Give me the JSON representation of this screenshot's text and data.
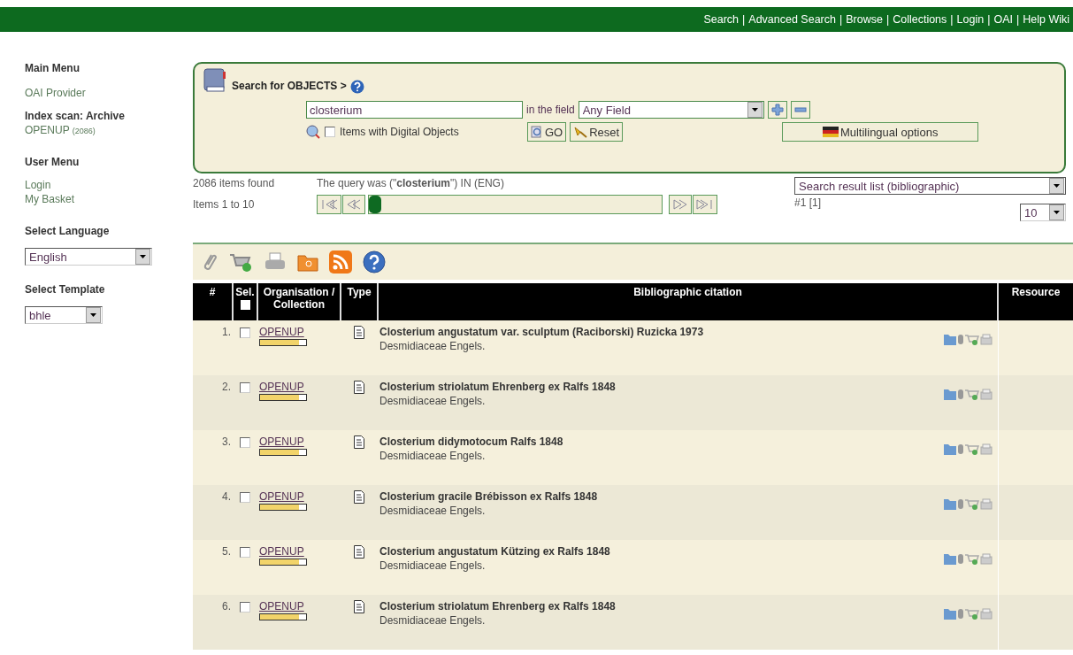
{
  "top_nav": [
    "Search",
    "Advanced Search",
    "Browse",
    "Collections",
    "Login",
    "OAI",
    "Help Wiki"
  ],
  "top_nav_separator": "|",
  "sidebar": {
    "main_menu": {
      "title": "Main Menu",
      "items": [
        "OAI Provider"
      ]
    },
    "index_scan": {
      "title": "Index scan: Archive",
      "item": "OPENUP",
      "count": "(2086)"
    },
    "user_menu": {
      "title": "User Menu",
      "items": [
        "Login",
        "My Basket"
      ]
    },
    "language": {
      "title": "Select Language",
      "value": "English"
    },
    "template": {
      "title": "Select Template",
      "value": "bhle"
    }
  },
  "search": {
    "title": "Search for OBJECTS >",
    "query": "closterium",
    "field_label": "in the field",
    "field": "Any Field",
    "digital_only": {
      "label": "Items with Digital Objects",
      "checked": false
    },
    "go": "GO",
    "reset": "Reset",
    "multilingual": "Multilingual options"
  },
  "results": {
    "found": "2086 items found",
    "query": "The query was (\"**closterium**\") IN (ENG)",
    "range": "Items 1 to 10",
    "view": "Search result list (bibliographic)",
    "page": "#1 [1]",
    "per_page": "10"
  },
  "table": {
    "select_all": {
      "checked": false
    },
    "columns": [
      "#",
      "Sel.",
      "Organisation / Collection",
      "Type",
      "Bibliographic citation",
      "Resource"
    ],
    "rows": [
      {
        "n": "1.",
        "selected": false,
        "org": "OPENUP",
        "level": 0.85,
        "title": "Closterium angustatum var. sculptum (Raciborski) Ruzicka 1973",
        "sub": "Desmidiaceae Engels."
      },
      {
        "n": "2.",
        "selected": false,
        "org": "OPENUP",
        "level": 0.85,
        "title": "Closterium striolatum Ehrenberg ex Ralfs 1848",
        "sub": "Desmidiaceae Engels."
      },
      {
        "n": "3.",
        "selected": false,
        "org": "OPENUP",
        "level": 0.85,
        "title": "Closterium didymotocum Ralfs 1848",
        "sub": "Desmidiaceae Engels."
      },
      {
        "n": "4.",
        "selected": false,
        "org": "OPENUP",
        "level": 0.85,
        "title": "Closterium gracile Brébisson ex Ralfs 1848",
        "sub": "Desmidiaceae Engels."
      },
      {
        "n": "5.",
        "selected": false,
        "org": "OPENUP",
        "level": 0.85,
        "title": "Closterium angustatum Kützing ex Ralfs 1848",
        "sub": "Desmidiaceae Engels."
      },
      {
        "n": "6.",
        "selected": false,
        "org": "OPENUP",
        "level": 0.85,
        "title": "Closterium striolatum Ehrenberg ex Ralfs 1848",
        "sub": "Desmidiaceae Engels."
      }
    ]
  }
}
